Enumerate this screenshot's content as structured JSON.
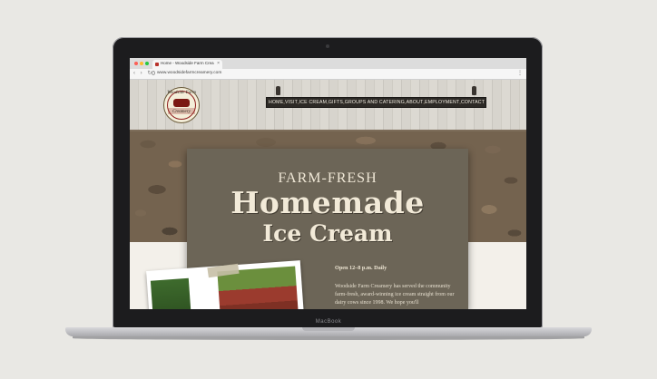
{
  "browser": {
    "tab_title": "Home - Woodside Farm Crea",
    "tab_close": "×",
    "nav_buttons": "‹ › ↻",
    "url": "www.woodsidefarmcreamery.com",
    "menu": "⋮"
  },
  "site": {
    "logo": {
      "top": "Woodside Farm",
      "bottom": "Creamery",
      "icon": "cow-icon"
    },
    "nav": [
      "HOME",
      "VISIT",
      "ICE CREAM",
      "GIFTS",
      "GROUPS AND CATERING",
      "ABOUT",
      "EMPLOYMENT",
      "CONTACT"
    ],
    "nav_separator": "•",
    "hero": {
      "kicker": "FARM-FRESH",
      "line1": "Homemade",
      "line2": "Ice Cream",
      "hours": "Open 12–8 p.m. Daily",
      "description": "Woodside Farm Creamery has served the community farm-fresh, award-winning ice cream straight from our dairy cows since 1998. We hope you'll"
    }
  },
  "device": {
    "label": "MacBook"
  },
  "colors": {
    "hero_bg": "#6c6557",
    "nav_bg": "#2d2a26",
    "brand_red": "#8f1d1d"
  }
}
